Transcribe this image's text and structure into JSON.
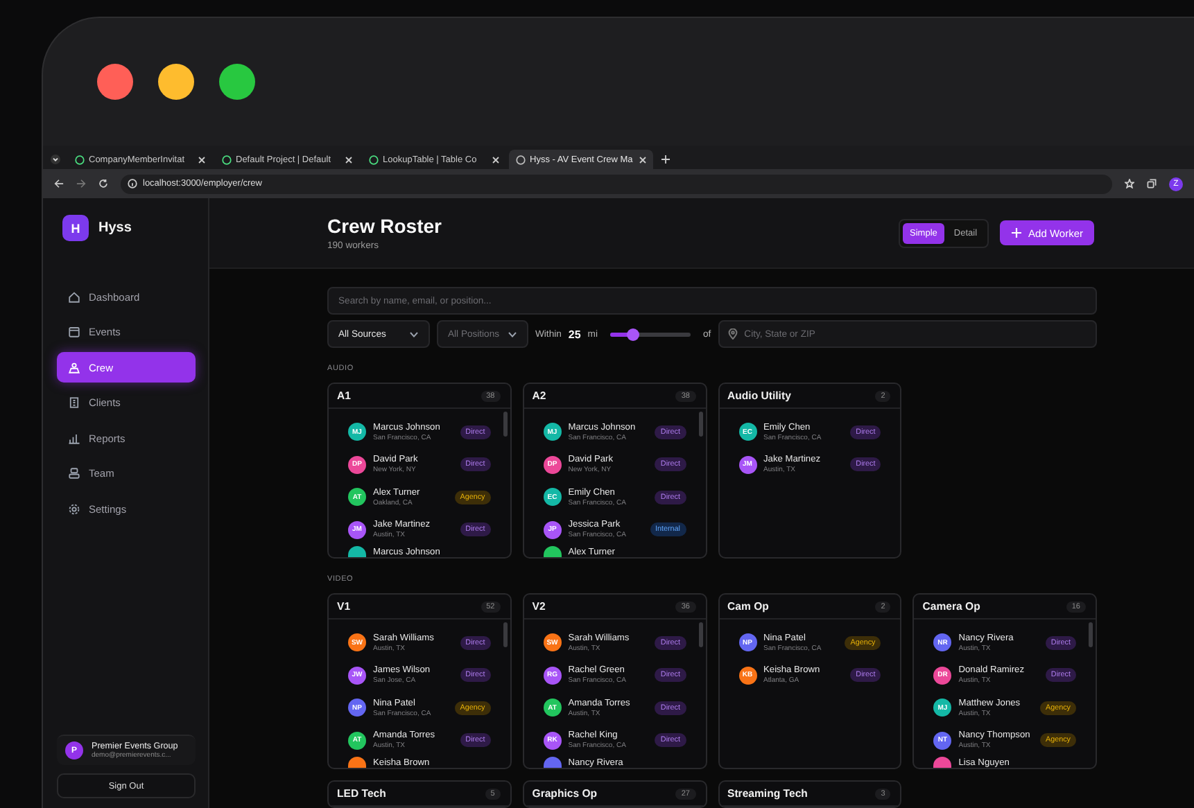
{
  "browser": {
    "tabs": [
      {
        "title": "CompanyMemberInvitat",
        "selected": false
      },
      {
        "title": "Default Project | Default",
        "selected": false
      },
      {
        "title": "LookupTable | Table Co",
        "selected": false
      },
      {
        "title": "Hyss - AV Event Crew Ma",
        "selected": true
      }
    ],
    "address": "localhost:3000/employer/crew",
    "profile_initial": "Z"
  },
  "sidebar": {
    "brand": {
      "initial": "H",
      "name": "Hyss"
    },
    "items": [
      {
        "label": "Dashboard",
        "kind": "home",
        "selected": false
      },
      {
        "label": "Events",
        "kind": "calendar",
        "selected": false
      },
      {
        "label": "Crew",
        "kind": "crew",
        "selected": true
      },
      {
        "label": "Clients",
        "kind": "building",
        "selected": false
      },
      {
        "label": "Reports",
        "kind": "chart",
        "selected": false
      },
      {
        "label": "Team",
        "kind": "team",
        "selected": false
      },
      {
        "label": "Settings",
        "kind": "gear",
        "selected": false
      }
    ],
    "account": {
      "initial": "P",
      "name": "Premier Events Group",
      "email": "demo@premierevents.c..."
    },
    "sign_out": "Sign Out"
  },
  "header": {
    "title": "Crew Roster",
    "subtitle": "190 workers",
    "view_modes": [
      {
        "label": "Simple",
        "selected": true
      },
      {
        "label": "Detail",
        "selected": false
      }
    ],
    "add_button": "Add Worker"
  },
  "filters": {
    "search": {
      "placeholder": "Search by name, email, or position..."
    },
    "source": {
      "value": "All Sources"
    },
    "position": {
      "placeholder": "All Positions"
    },
    "radius": {
      "label": "Within",
      "value": "25",
      "unit": "mi",
      "level": 0.28,
      "suffix": "of"
    },
    "location": {
      "placeholder": "City, State or ZIP"
    }
  },
  "sections": [
    {
      "label": "AUDIO",
      "cards": [
        {
          "title": "A1",
          "count": "38",
          "workers": [
            {
              "kind": "full",
              "initials": "MJ",
              "name": "Marcus Johnson",
              "location": "San Francisco, CA",
              "color": "#14b8a6",
              "badge": {
                "label": "Direct",
                "kind": "direct"
              }
            },
            {
              "kind": "full",
              "initials": "DP",
              "name": "David Park",
              "location": "New York, NY",
              "color": "#ec4899",
              "badge": {
                "label": "Direct",
                "kind": "direct"
              }
            },
            {
              "kind": "full",
              "initials": "AT",
              "name": "Alex Turner",
              "location": "Oakland, CA",
              "color": "#22c55e",
              "badge": {
                "label": "Agency",
                "kind": "agency"
              }
            },
            {
              "kind": "full",
              "initials": "JM",
              "name": "Jake Martinez",
              "location": "Austin, TX",
              "color": "#a855f7",
              "badge": {
                "label": "Direct",
                "kind": "direct"
              }
            },
            {
              "kind": "partial",
              "name": "Marcus Johnson",
              "color": "#14b8a6"
            }
          ]
        },
        {
          "title": "A2",
          "count": "38",
          "workers": [
            {
              "kind": "full",
              "initials": "MJ",
              "name": "Marcus Johnson",
              "location": "San Francisco, CA",
              "color": "#14b8a6",
              "badge": {
                "label": "Direct",
                "kind": "direct"
              }
            },
            {
              "kind": "full",
              "initials": "DP",
              "name": "David Park",
              "location": "New York, NY",
              "color": "#ec4899",
              "badge": {
                "label": "Direct",
                "kind": "direct"
              }
            },
            {
              "kind": "full",
              "initials": "EC",
              "name": "Emily Chen",
              "location": "San Francisco, CA",
              "color": "#14b8a6",
              "badge": {
                "label": "Direct",
                "kind": "direct"
              }
            },
            {
              "kind": "full",
              "initials": "JP",
              "name": "Jessica Park",
              "location": "San Francisco, CA",
              "color": "#a855f7",
              "badge": {
                "label": "Internal",
                "kind": "internal"
              }
            },
            {
              "kind": "partial",
              "name": "Alex Turner",
              "color": "#22c55e"
            }
          ]
        },
        {
          "title": "Audio Utility",
          "count": "2",
          "workers": [
            {
              "kind": "full",
              "initials": "EC",
              "name": "Emily Chen",
              "location": "San Francisco, CA",
              "color": "#14b8a6",
              "badge": {
                "label": "Direct",
                "kind": "direct"
              }
            },
            {
              "kind": "full",
              "initials": "JM",
              "name": "Jake Martinez",
              "location": "Austin, TX",
              "color": "#a855f7",
              "badge": {
                "label": "Direct",
                "kind": "direct"
              }
            }
          ]
        }
      ]
    },
    {
      "label": "VIDEO",
      "cards": [
        {
          "title": "V1",
          "count": "52",
          "workers": [
            {
              "kind": "full",
              "initials": "SW",
              "name": "Sarah Williams",
              "location": "Austin, TX",
              "color": "#f97316",
              "badge": {
                "label": "Direct",
                "kind": "direct"
              }
            },
            {
              "kind": "full",
              "initials": "JW",
              "name": "James Wilson",
              "location": "San Jose, CA",
              "color": "#a855f7",
              "badge": {
                "label": "Direct",
                "kind": "direct"
              }
            },
            {
              "kind": "full",
              "initials": "NP",
              "name": "Nina Patel",
              "location": "San Francisco, CA",
              "color": "#6366f1",
              "badge": {
                "label": "Agency",
                "kind": "agency"
              }
            },
            {
              "kind": "full",
              "initials": "AT",
              "name": "Amanda Torres",
              "location": "Austin, TX",
              "color": "#22c55e",
              "badge": {
                "label": "Direct",
                "kind": "direct"
              }
            },
            {
              "kind": "partial",
              "name": "Keisha Brown",
              "color": "#f97316"
            }
          ]
        },
        {
          "title": "V2",
          "count": "36",
          "workers": [
            {
              "kind": "full",
              "initials": "SW",
              "name": "Sarah Williams",
              "location": "Austin, TX",
              "color": "#f97316",
              "badge": {
                "label": "Direct",
                "kind": "direct"
              }
            },
            {
              "kind": "full",
              "initials": "RG",
              "name": "Rachel Green",
              "location": "San Francisco, CA",
              "color": "#a855f7",
              "badge": {
                "label": "Direct",
                "kind": "direct"
              }
            },
            {
              "kind": "full",
              "initials": "AT",
              "name": "Amanda Torres",
              "location": "Austin, TX",
              "color": "#22c55e",
              "badge": {
                "label": "Direct",
                "kind": "direct"
              }
            },
            {
              "kind": "full",
              "initials": "RK",
              "name": "Rachel King",
              "location": "San Francisco, CA",
              "color": "#a855f7",
              "badge": {
                "label": "Direct",
                "kind": "direct"
              }
            },
            {
              "kind": "partial",
              "name": "Nancy Rivera",
              "color": "#6366f1"
            }
          ]
        },
        {
          "title": "Cam Op",
          "count": "2",
          "workers": [
            {
              "kind": "full",
              "initials": "NP",
              "name": "Nina Patel",
              "location": "San Francisco, CA",
              "color": "#6366f1",
              "badge": {
                "label": "Agency",
                "kind": "agency"
              }
            },
            {
              "kind": "full",
              "initials": "KB",
              "name": "Keisha Brown",
              "location": "Atlanta, GA",
              "color": "#f97316",
              "badge": {
                "label": "Direct",
                "kind": "direct"
              }
            }
          ]
        },
        {
          "title": "Camera Op",
          "count": "16",
          "workers": [
            {
              "kind": "full",
              "initials": "NR",
              "name": "Nancy Rivera",
              "location": "Austin, TX",
              "color": "#6366f1",
              "badge": {
                "label": "Direct",
                "kind": "direct"
              }
            },
            {
              "kind": "full",
              "initials": "DR",
              "name": "Donald Ramirez",
              "location": "Austin, TX",
              "color": "#ec4899",
              "badge": {
                "label": "Direct",
                "kind": "direct"
              }
            },
            {
              "kind": "full",
              "initials": "MJ",
              "name": "Matthew Jones",
              "location": "Austin, TX",
              "color": "#14b8a6",
              "badge": {
                "label": "Agency",
                "kind": "agency"
              }
            },
            {
              "kind": "full",
              "initials": "NT",
              "name": "Nancy Thompson",
              "location": "Austin, TX",
              "color": "#6366f1",
              "badge": {
                "label": "Agency",
                "kind": "agency"
              }
            },
            {
              "kind": "partial",
              "name": "Lisa Nguyen",
              "color": "#ec4899"
            }
          ]
        },
        {
          "title": "LED Tech",
          "count": "5"
        },
        {
          "title": "Graphics Op",
          "count": "27"
        },
        {
          "title": "Streaming Tech",
          "count": "3"
        }
      ]
    }
  ]
}
